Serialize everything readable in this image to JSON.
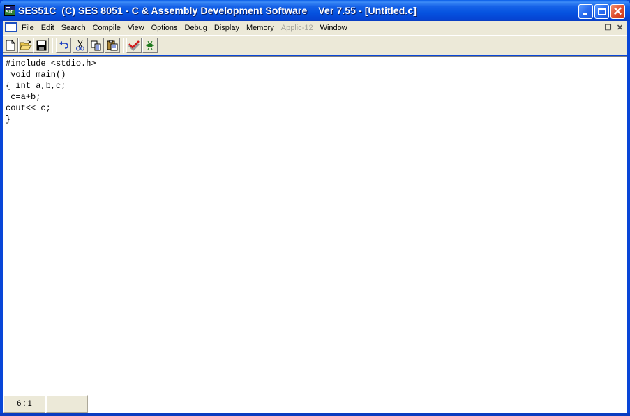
{
  "window": {
    "title": "SES51C  (C) SES 8051 - C & Assembly Development Software    Ver 7.55 - [Untitled.c]",
    "app_icon_text": "SIC",
    "close_glyph": "✕"
  },
  "menubar": {
    "items": [
      {
        "label": "File",
        "enabled": true
      },
      {
        "label": "Edit",
        "enabled": true
      },
      {
        "label": "Search",
        "enabled": true
      },
      {
        "label": "Compile",
        "enabled": true
      },
      {
        "label": "View",
        "enabled": true
      },
      {
        "label": "Options",
        "enabled": true
      },
      {
        "label": "Debug",
        "enabled": true
      },
      {
        "label": "Display",
        "enabled": true
      },
      {
        "label": "Memory",
        "enabled": true
      },
      {
        "label": "Applic-12",
        "enabled": false
      },
      {
        "label": "Window",
        "enabled": true
      }
    ],
    "mdi_controls": {
      "minimize": "_",
      "restore": "❐",
      "close": "✕"
    }
  },
  "toolbar": {
    "buttons": [
      "new-file",
      "open-folder",
      "save",
      "undo",
      "cut",
      "copy",
      "paste",
      "check-compile",
      "debug-bug"
    ]
  },
  "editor": {
    "content": "#include <stdio.h>\n void main()\n{ int a,b,c;\n c=a+b;\ncout<< c;\n}"
  },
  "statusbar": {
    "position": "6 : 1",
    "panel2": ""
  },
  "colors": {
    "titlebar": "#0553e0",
    "chrome": "#ece9d8",
    "disabled_text": "#a6a59c"
  }
}
